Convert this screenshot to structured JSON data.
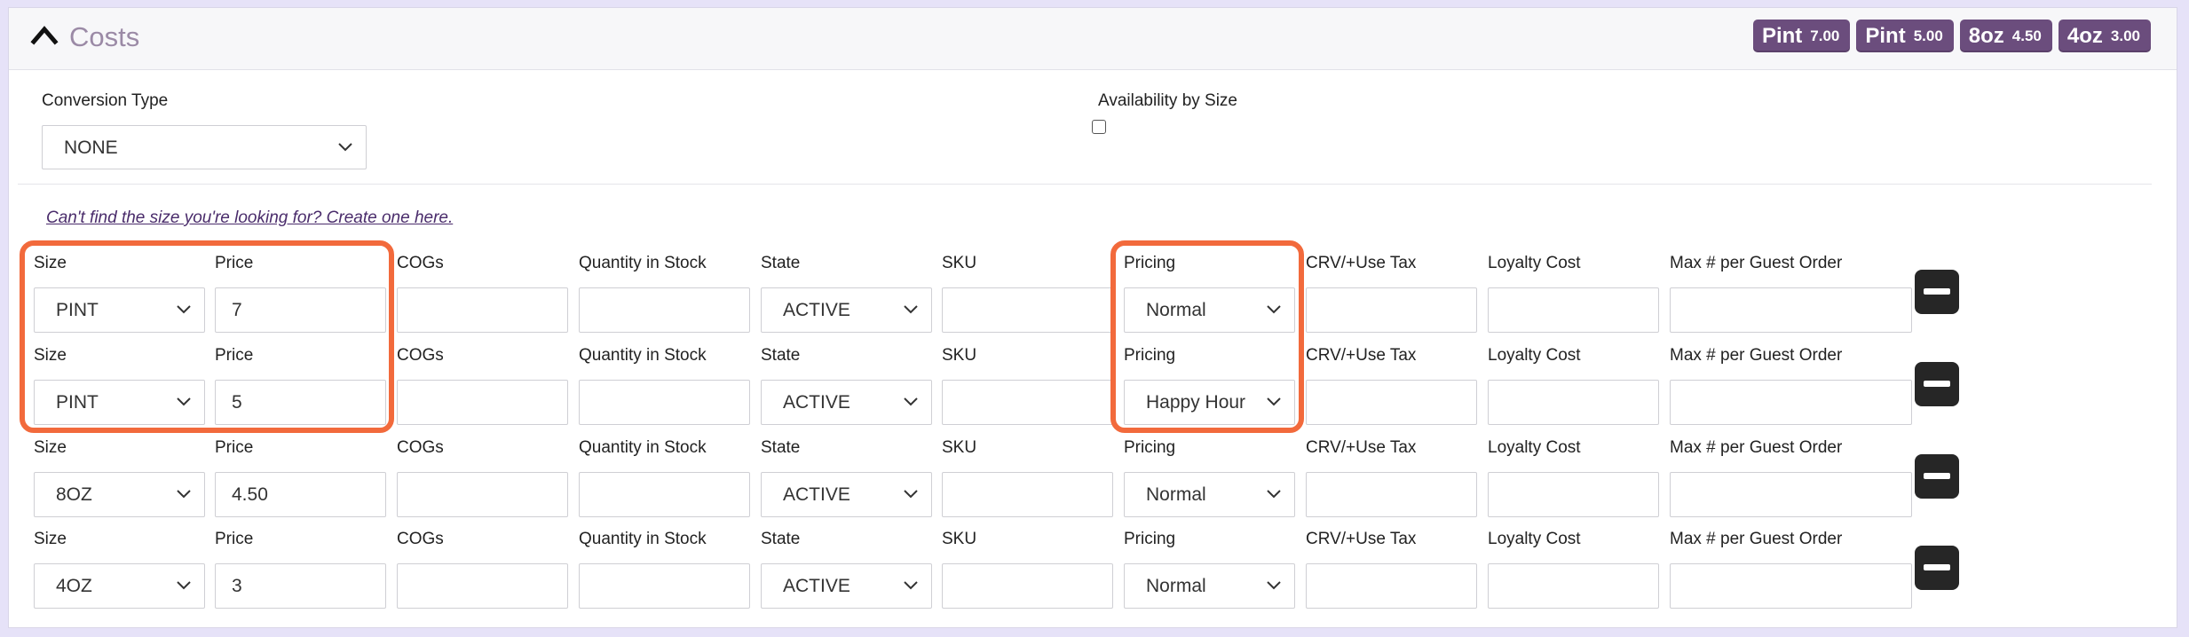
{
  "section": {
    "title": "Costs",
    "badges": [
      {
        "size": "Pint",
        "price": "7.00"
      },
      {
        "size": "Pint",
        "price": "5.00"
      },
      {
        "size": "8oz",
        "price": "4.50"
      },
      {
        "size": "4oz",
        "price": "3.00"
      }
    ]
  },
  "conversion": {
    "label": "Conversion Type",
    "value": "NONE"
  },
  "availability": {
    "label": "Availability by Size",
    "checked": false
  },
  "create_size_link": "Can't find the size you're looking for? Create one here.",
  "columns": {
    "size": "Size",
    "price": "Price",
    "cogs": "COGs",
    "quantity": "Quantity in Stock",
    "state": "State",
    "sku": "SKU",
    "pricing": "Pricing",
    "crv": "CRV/+Use Tax",
    "loyalty": "Loyalty Cost",
    "max": "Max # per Guest Order"
  },
  "rows": [
    {
      "size": "PINT",
      "price": "7",
      "cogs": "",
      "quantity": "",
      "state": "ACTIVE",
      "sku": "",
      "pricing": "Normal",
      "crv": "",
      "loyalty": "",
      "max": ""
    },
    {
      "size": "PINT",
      "price": "5",
      "cogs": "",
      "quantity": "",
      "state": "ACTIVE",
      "sku": "",
      "pricing": "Happy Hour",
      "crv": "",
      "loyalty": "",
      "max": ""
    },
    {
      "size": "8OZ",
      "price": "4.50",
      "cogs": "",
      "quantity": "",
      "state": "ACTIVE",
      "sku": "",
      "pricing": "Normal",
      "crv": "",
      "loyalty": "",
      "max": ""
    },
    {
      "size": "4OZ",
      "price": "3",
      "cogs": "",
      "quantity": "",
      "state": "ACTIVE",
      "sku": "",
      "pricing": "Normal",
      "crv": "",
      "loyalty": "",
      "max": ""
    }
  ],
  "colors": {
    "accent": "#6b4d7d",
    "highlight": "#f26a3c",
    "title": "#9b8aa6",
    "link": "#4a2c6b",
    "page_background": "#e6e2f8"
  },
  "icons": {
    "collapse": "chevron-up-icon",
    "select": "chevron-down-icon",
    "remove": "minus-icon"
  }
}
